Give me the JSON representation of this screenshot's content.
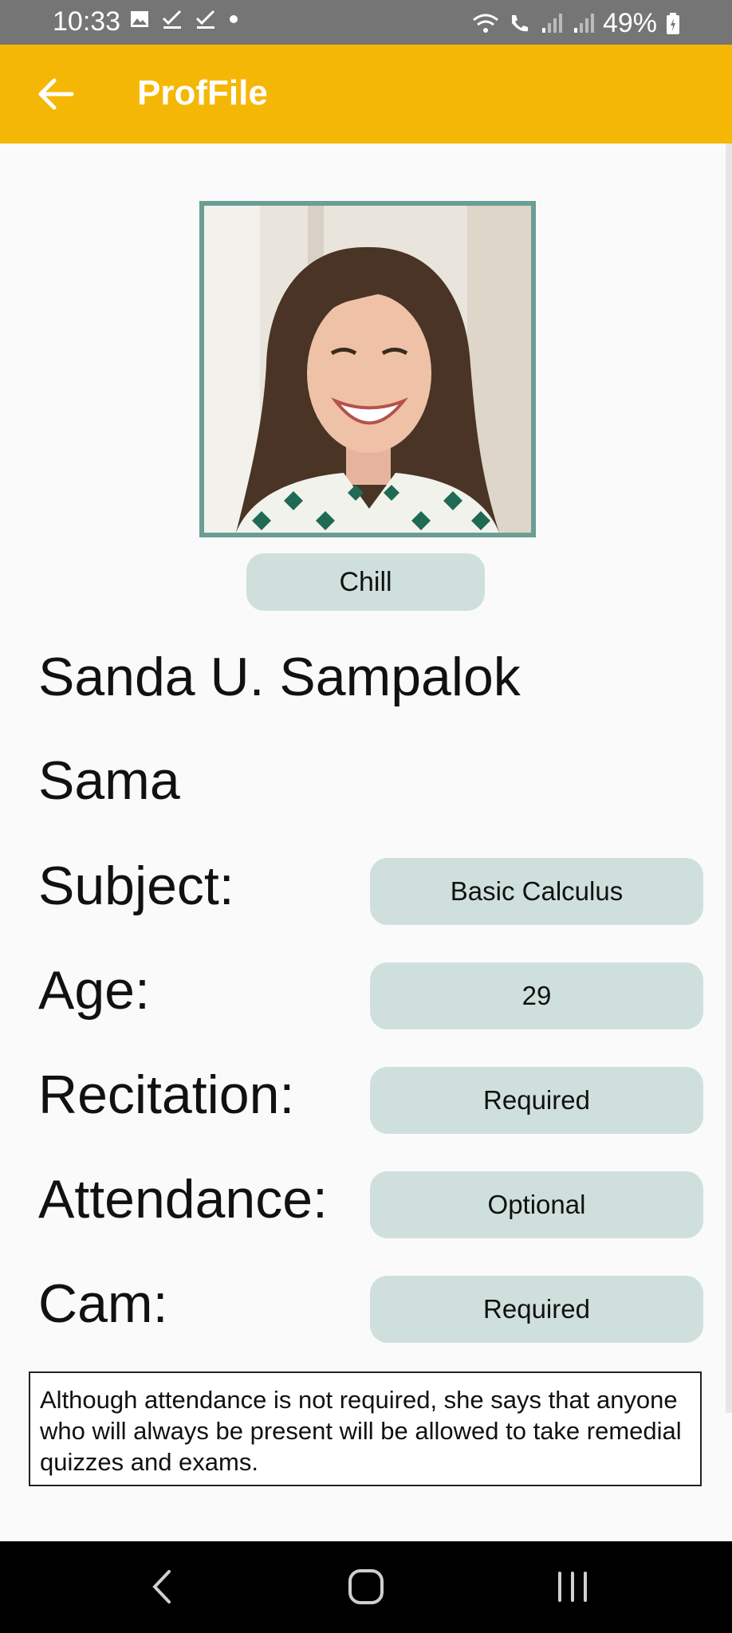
{
  "status_bar": {
    "time": "10:33",
    "battery": "49%",
    "left_icons": [
      "image-icon",
      "check-icon",
      "check-icon",
      "dot-icon"
    ],
    "right_icons": [
      "wifi-icon",
      "call-icon",
      "signal-icon",
      "signal-icon",
      "battery-icon"
    ]
  },
  "app_bar": {
    "title": "ProfFile",
    "background": "#f5b706"
  },
  "profile": {
    "mood": "Chill",
    "name": "Sanda U. Sampalok",
    "nickname": "Sama",
    "fields": [
      {
        "label": "Subject:",
        "value": "Basic Calculus"
      },
      {
        "label": "Age:",
        "value": "29"
      },
      {
        "label": "Recitation:",
        "value": "Required"
      },
      {
        "label": "Attendance:",
        "value": "Optional"
      },
      {
        "label": "Cam:",
        "value": "Required"
      }
    ],
    "note": "Although attendance is not required, she says that anyone who will always be present will be allowed to take remedial quizzes and exams."
  },
  "colors": {
    "chip": "#cfe0dc",
    "frame": "#6b9e94"
  },
  "nav_bar": {
    "icons": [
      "back-icon",
      "home-icon",
      "recents-icon"
    ]
  }
}
